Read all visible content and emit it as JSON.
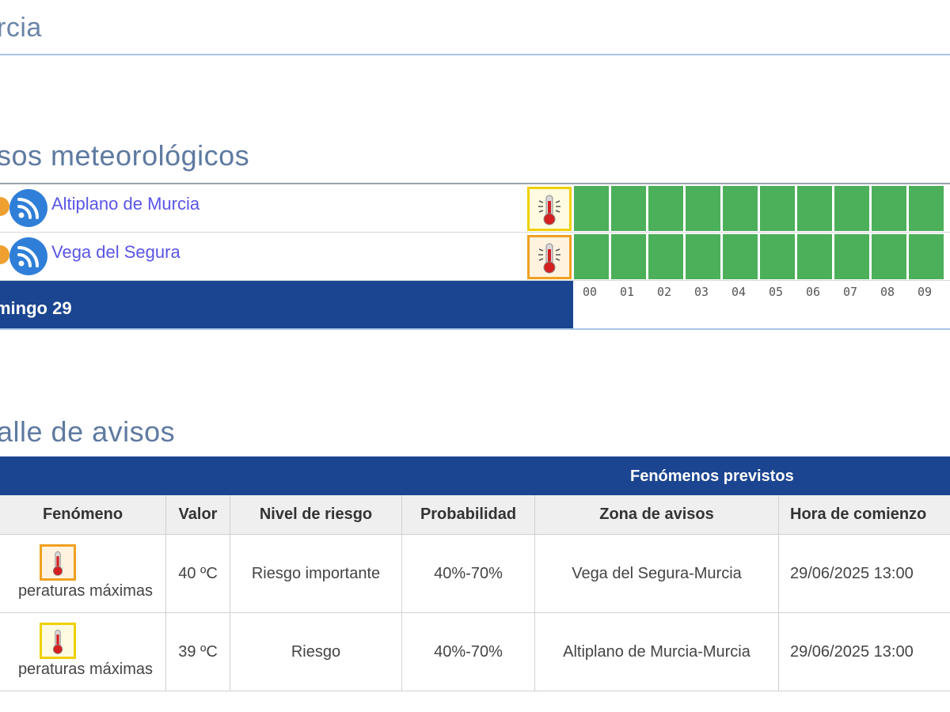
{
  "header": {
    "title": "rcia"
  },
  "sections": {
    "avisos_title": "sos meteorológicos",
    "detalle_title": "alle de avisos"
  },
  "timeline": {
    "zones": [
      {
        "name": "Altiplano de Murcia",
        "warning_level": "yellow",
        "warning_icon": "thermometer-icon"
      },
      {
        "name": "Vega del Segura",
        "warning_level": "orange",
        "warning_icon": "thermometer-icon"
      }
    ],
    "day_label": "mingo 29",
    "hours": [
      "00",
      "01",
      "02",
      "03",
      "04",
      "05",
      "06",
      "07",
      "08",
      "09"
    ],
    "cell_color": "#4caf5a"
  },
  "details": {
    "group_header": "Fenómenos previstos",
    "columns": [
      "Fenómeno",
      "Valor",
      "Nivel de riesgo",
      "Probabilidad",
      "Zona de avisos",
      "Hora de comienzo"
    ],
    "rows": [
      {
        "fenomeno": "peraturas máximas",
        "icon_level": "orange",
        "valor": "40 ºC",
        "nivel": "Riesgo importante",
        "probabilidad": "40%-70%",
        "zona": "Vega del Segura-Murcia",
        "hora": "29/06/2025 13:00"
      },
      {
        "fenomeno": "peraturas máximas",
        "icon_level": "yellow",
        "valor": "39 ºC",
        "nivel": "Riesgo",
        "probabilidad": "40%-70%",
        "zona": "Altiplano de Murcia-Murcia",
        "hora": "29/06/2025 13:00"
      }
    ]
  },
  "colors": {
    "primary_blue": "#1b4590",
    "link": "#5a55e6",
    "rss_blue": "#2f7fd8",
    "warning_yellow": "#f0d000",
    "warning_orange": "#f0a020",
    "ok_green": "#4caf5a"
  }
}
